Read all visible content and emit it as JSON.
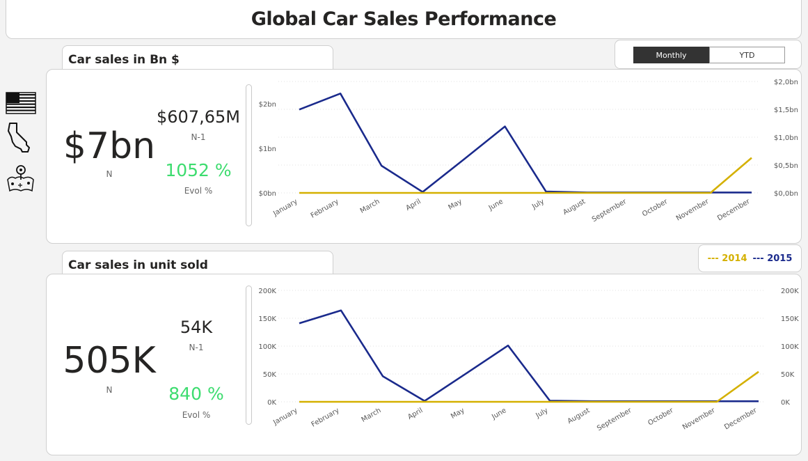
{
  "page": {
    "title": "Global Car Sales Performance"
  },
  "toggle": {
    "monthly_label": "Monthly",
    "ytd_label": "YTD",
    "selected": "Monthly"
  },
  "sidebar": {
    "icons": [
      "usa-flag-icon",
      "california-map-icon",
      "map-pins-icon"
    ]
  },
  "legend": {
    "items": [
      {
        "label": "--- 2014",
        "color": "#d4b000"
      },
      {
        "label": "--- 2015",
        "color": "#1a2a8c"
      }
    ]
  },
  "colors": {
    "series_2014": "#d4b000",
    "series_2015": "#1a2a8c",
    "evol": "#3ddc6f"
  },
  "sales_bn": {
    "tab_title": "Car sales in Bn $",
    "kpi_n": "$7bn",
    "kpi_n_label": "N",
    "kpi_n1": "$607,65M",
    "kpi_n1_label": "N-1",
    "kpi_evol": "1052 %",
    "kpi_evol_label": "Evol %"
  },
  "sales_units": {
    "tab_title": "Car sales in unit sold",
    "kpi_n": "505K",
    "kpi_n_label": "N",
    "kpi_n1": "54K",
    "kpi_n1_label": "N-1",
    "kpi_evol": "840 %",
    "kpi_evol_label": "Evol %"
  },
  "chart_data": [
    {
      "type": "line",
      "categories": [
        "January",
        "February",
        "March",
        "April",
        "May",
        "June",
        "July",
        "August",
        "September",
        "October",
        "November",
        "December"
      ],
      "series": [
        {
          "name": "2015",
          "color": "#1a2a8c",
          "axis": "left",
          "values": [
            1.87,
            2.23,
            0.61,
            0.02,
            0.75,
            1.49,
            0.03,
            0.01,
            0.01,
            0.01,
            0.01,
            0.01
          ]
        },
        {
          "name": "2014",
          "color": "#d4b000",
          "axis": "right",
          "values": [
            0.0,
            0.0,
            0.0,
            0.0,
            0.0,
            0.0,
            0.0,
            0.0,
            0.0,
            0.0,
            0.0,
            0.63
          ]
        }
      ],
      "y_left_ticks": [
        "$0bn",
        "$1bn",
        "$2bn"
      ],
      "y_left_values": [
        0,
        1,
        2
      ],
      "y_left_range": [
        0,
        2.5
      ],
      "y_right_ticks": [
        "$0,0bn",
        "$0,5bn",
        "$1,0bn",
        "$1,5bn",
        "$2,0bn"
      ],
      "y_right_values": [
        0,
        0.5,
        1.0,
        1.5,
        2.0
      ],
      "y_right_range": [
        0,
        2.0
      ],
      "grid": true
    },
    {
      "type": "line",
      "categories": [
        "January",
        "February",
        "March",
        "April",
        "May",
        "June",
        "July",
        "August",
        "September",
        "October",
        "November",
        "December"
      ],
      "series": [
        {
          "name": "2015",
          "color": "#1a2a8c",
          "axis": "left",
          "values": [
            141000,
            164000,
            46000,
            1500,
            51000,
            101000,
            2000,
            1000,
            1000,
            1000,
            1000,
            1000
          ]
        },
        {
          "name": "2014",
          "color": "#d4b000",
          "axis": "right",
          "values": [
            0,
            0,
            0,
            0,
            0,
            0,
            0,
            0,
            0,
            0,
            0,
            54000
          ]
        }
      ],
      "y_left_ticks": [
        "0K",
        "50K",
        "100K",
        "150K",
        "200K"
      ],
      "y_left_values": [
        0,
        50000,
        100000,
        150000,
        200000
      ],
      "y_left_range": [
        0,
        200000
      ],
      "y_right_ticks": [
        "0K",
        "50K",
        "100K",
        "150K",
        "200K"
      ],
      "y_right_values": [
        0,
        50000,
        100000,
        150000,
        200000
      ],
      "y_right_range": [
        0,
        200000
      ],
      "grid": true
    }
  ]
}
